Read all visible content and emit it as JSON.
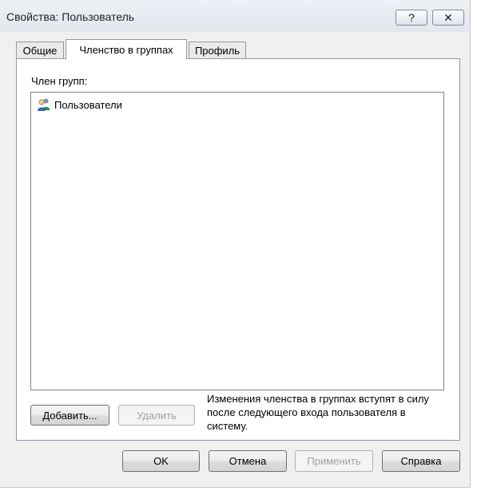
{
  "window": {
    "title": "Свойства: Пользователь",
    "help_glyph": "?",
    "close_glyph": "✕"
  },
  "tabs": [
    {
      "label": "Общие",
      "active": false
    },
    {
      "label": "Членство в группах",
      "active": true
    },
    {
      "label": "Профиль",
      "active": false
    }
  ],
  "membership": {
    "label": "Член групп:",
    "groups": [
      {
        "name": "Пользователи",
        "icon": "users-group-icon"
      }
    ],
    "add_label": "Добавить...",
    "remove_label": "Удалить",
    "remove_enabled": false,
    "note": "Изменения членства в группах вступят в силу после следующего входа пользователя в систему."
  },
  "footer": {
    "ok_label": "OK",
    "cancel_label": "Отмена",
    "apply_label": "Применить",
    "apply_enabled": false,
    "help_label": "Справка"
  }
}
